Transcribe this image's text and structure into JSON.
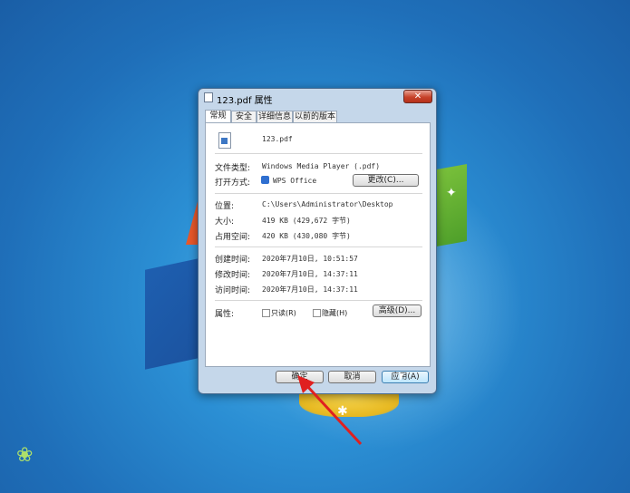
{
  "window": {
    "title": "123.pdf 属性",
    "close_label": "✕"
  },
  "tabs": [
    {
      "label": "常规",
      "active": true
    },
    {
      "label": "安全",
      "active": false
    },
    {
      "label": "详细信息",
      "active": false
    },
    {
      "label": "以前的版本",
      "active": false
    }
  ],
  "general": {
    "file_name": "123.pdf",
    "file_type_label": "文件类型:",
    "file_type_value": "Windows Media Player (.pdf)",
    "open_with_label": "打开方式:",
    "open_with_value": "WPS Office",
    "change_button": "更改(C)...",
    "location_label": "位置:",
    "location_value": "C:\\Users\\Administrator\\Desktop",
    "size_label": "大小:",
    "size_value": "419 KB (429,672 字节)",
    "size_on_disk_label": "占用空间:",
    "size_on_disk_value": "420 KB (430,080 字节)",
    "created_label": "创建时间:",
    "created_value": "2020年7月10日, 10:51:57",
    "modified_label": "修改时间:",
    "modified_value": "2020年7月10日, 14:37:11",
    "accessed_label": "访问时间:",
    "accessed_value": "2020年7月10日, 14:37:11",
    "attributes_label": "属性:",
    "readonly_label": "只读(R)",
    "hidden_label": "隐藏(H)",
    "advanced_button": "高级(D)..."
  },
  "footer": {
    "ok_button": "确定",
    "cancel_button": "取消",
    "apply_button": "应用(A)"
  },
  "colors": {
    "annotation_arrow": "#e02020",
    "desktop_blue": "#2b8fd4"
  }
}
